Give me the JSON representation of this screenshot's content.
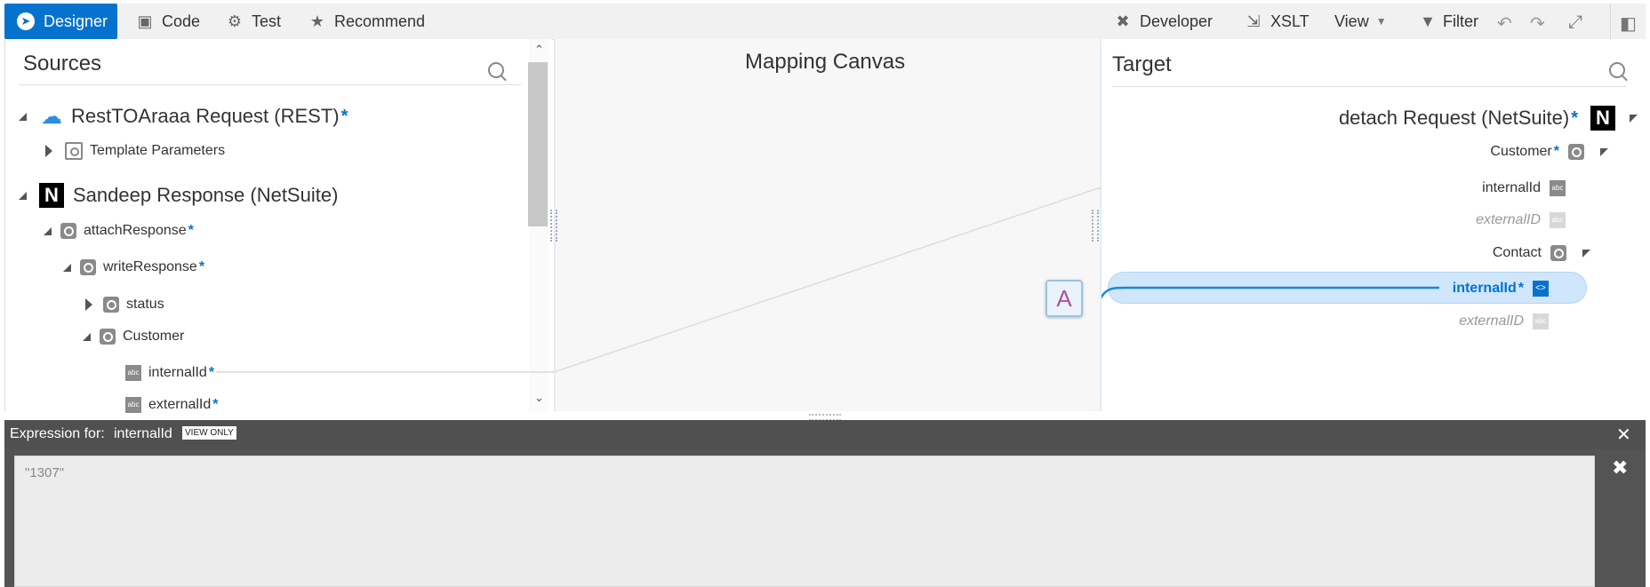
{
  "toolbar": {
    "designer": "Designer",
    "code": "Code",
    "test": "Test",
    "recommend": "Recommend",
    "developer": "Developer",
    "xslt": "XSLT",
    "view": "View",
    "filter": "Filter"
  },
  "sources": {
    "title": "Sources",
    "items": [
      {
        "label": "RestTOAraaa Request (REST)",
        "required": "*"
      },
      {
        "label": "Template Parameters"
      },
      {
        "label": "Sandeep Response (NetSuite)",
        "logo": "N"
      },
      {
        "label": "attachResponse",
        "required": "*"
      },
      {
        "label": "writeResponse",
        "required": "*"
      },
      {
        "label": "status"
      },
      {
        "label": "Customer"
      },
      {
        "label": "internalId",
        "required": "*",
        "icon_text": "abc"
      },
      {
        "label": "externalId",
        "required": "*",
        "icon_text": "abc"
      }
    ]
  },
  "canvas": {
    "title": "Mapping Canvas",
    "function_badge": "A"
  },
  "target": {
    "title": "Target",
    "items": [
      {
        "label": "detach Request (NetSuite)",
        "required": "*",
        "logo": "N"
      },
      {
        "label": "Customer",
        "required": "*"
      },
      {
        "label": "internalId",
        "icon_text": "abc"
      },
      {
        "label": "externalID",
        "icon_text": "abc"
      },
      {
        "label": "Contact"
      },
      {
        "label": "internalId",
        "required": "*"
      },
      {
        "label": "externalID",
        "icon_text": "abc"
      }
    ]
  },
  "expression": {
    "label": "Expression for:",
    "field": "internalId",
    "badge": "VIEW ONLY",
    "value": "\"1307\""
  },
  "colors": {
    "accent": "#0572ce",
    "highlight": "#cfe6fb",
    "mapped_line": "#1a86d8"
  }
}
